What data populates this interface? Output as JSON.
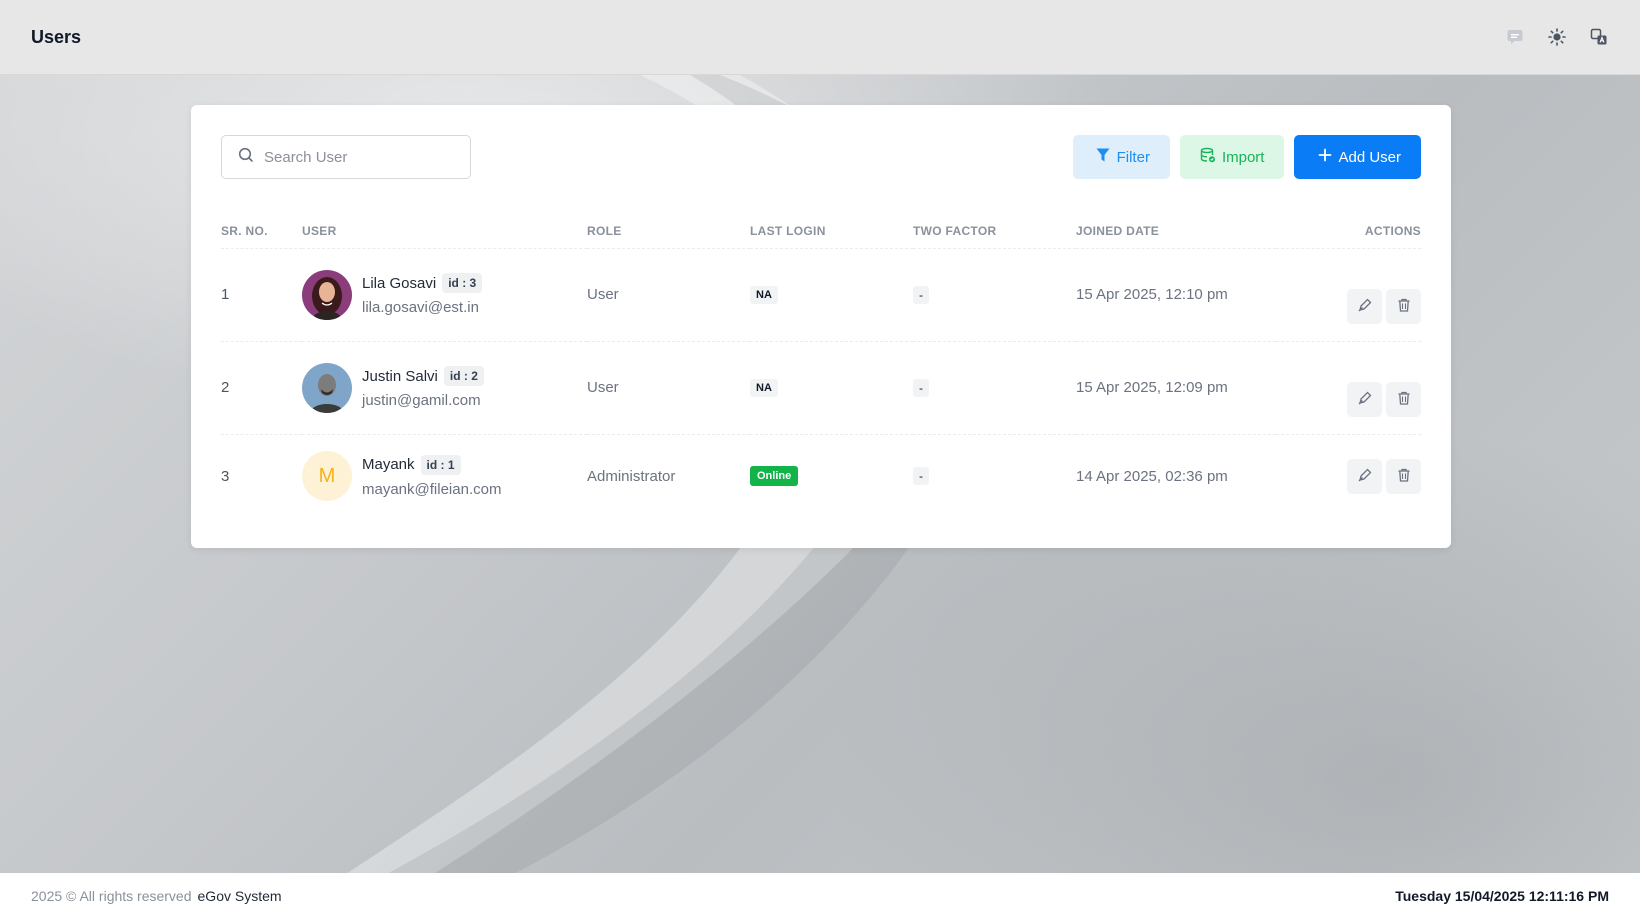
{
  "header": {
    "title": "Users",
    "icons": [
      "chat-icon",
      "sun-icon",
      "translate-icon"
    ]
  },
  "toolbar": {
    "search_placeholder": "Search User",
    "filter_label": "Filter",
    "import_label": "Import",
    "add_label": "Add User"
  },
  "table": {
    "columns": [
      "SR. NO.",
      "USER",
      "ROLE",
      "LAST LOGIN",
      "TWO FACTOR",
      "JOINED DATE",
      "ACTIONS"
    ],
    "rows": [
      {
        "sr": "1",
        "name": "Lila Gosavi",
        "id": "id : 3",
        "email": "lila.gosavi@est.in",
        "role": "User",
        "last_login": "NA",
        "two_factor": "-",
        "joined": "15 Apr 2025, 12:10 pm"
      },
      {
        "sr": "2",
        "name": "Justin Salvi",
        "id": "id : 2",
        "email": "justin@gamil.com",
        "role": "User",
        "last_login": "NA",
        "two_factor": "-",
        "joined": "15 Apr 2025, 12:09 pm"
      },
      {
        "sr": "3",
        "name": "Mayank",
        "id": "id : 1",
        "avatar_letter": "M",
        "email": "mayank@fileian.com",
        "role": "Administrator",
        "last_login": "Online",
        "two_factor": "-",
        "joined": "14 Apr 2025, 02:36 pm"
      }
    ]
  },
  "footer": {
    "copyright": "2025 © All rights reserved",
    "brand": "eGov System",
    "datetime": "Tuesday 15/04/2025 12:11:16 PM"
  },
  "colors": {
    "primary": "#0a7cf5",
    "filter_bg": "#deeefb",
    "import_bg": "#dcf7e6",
    "import_text": "#19b35a",
    "online": "#12b348"
  }
}
